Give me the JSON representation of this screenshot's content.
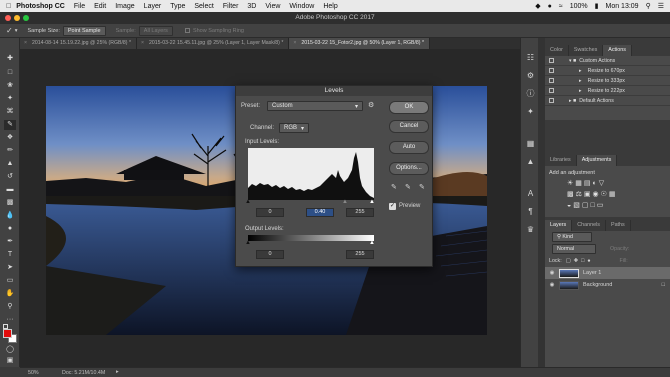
{
  "menubar": {
    "items": [
      "Photoshop CC",
      "File",
      "Edit",
      "Image",
      "Layer",
      "Type",
      "Select",
      "Filter",
      "3D",
      "View",
      "Window",
      "Help"
    ],
    "right": {
      "battery": "100%",
      "clock": "Mon 13:09"
    }
  },
  "window": {
    "title": "Adobe Photoshop CC 2017"
  },
  "options": {
    "sample_size_label": "Sample Size:",
    "sample_size_value": "Point Sample",
    "sample_label": "Sample:",
    "sample_value": "All Layers",
    "sampling_ring": "Show Sampling Ring"
  },
  "tabs": [
    {
      "label": "2014-08-14 15.19.22.jpg @ 25% (RGB/8) *"
    },
    {
      "label": "2015-03-22 15.45.11.jpg @ 25% (Layer 1, Layer Mask/8) *"
    },
    {
      "label": "2015-03-22 15_Fotor2.jpg @ 50% (Layer 1, RGB/8) *"
    }
  ],
  "actions_panel": {
    "tabs": [
      "Color",
      "Swatches",
      "Actions"
    ],
    "rows": [
      "Custom Actions",
      "Resize to 670px",
      "Resize to 333px",
      "Resize to 222px",
      "Default Actions"
    ]
  },
  "adjustments_panel": {
    "tabs": [
      "Libraries",
      "Adjustments"
    ],
    "title": "Add an adjustment"
  },
  "layers_panel": {
    "tabs": [
      "Layers",
      "Channels",
      "Paths"
    ],
    "kind": "Kind",
    "blend": "Normal",
    "opacity_label": "Opacity:",
    "lock_label": "Lock:",
    "fill_label": "Fill:",
    "layers": [
      "Layer 1",
      "Background"
    ]
  },
  "levels_dialog": {
    "title": "Levels",
    "preset_label": "Preset:",
    "preset_value": "Custom",
    "channel_label": "Channel:",
    "channel_value": "RGB",
    "input_label": "Input Levels:",
    "input_black": "0",
    "input_gamma": "0.40",
    "input_white": "255",
    "output_label": "Output Levels:",
    "output_black": "0",
    "output_white": "255",
    "buttons": {
      "ok": "OK",
      "cancel": "Cancel",
      "auto": "Auto",
      "options": "Options..."
    },
    "preview_label": "Preview"
  },
  "status": {
    "zoom": "50%",
    "doc": "Doc: 5.21M/10.4M"
  }
}
